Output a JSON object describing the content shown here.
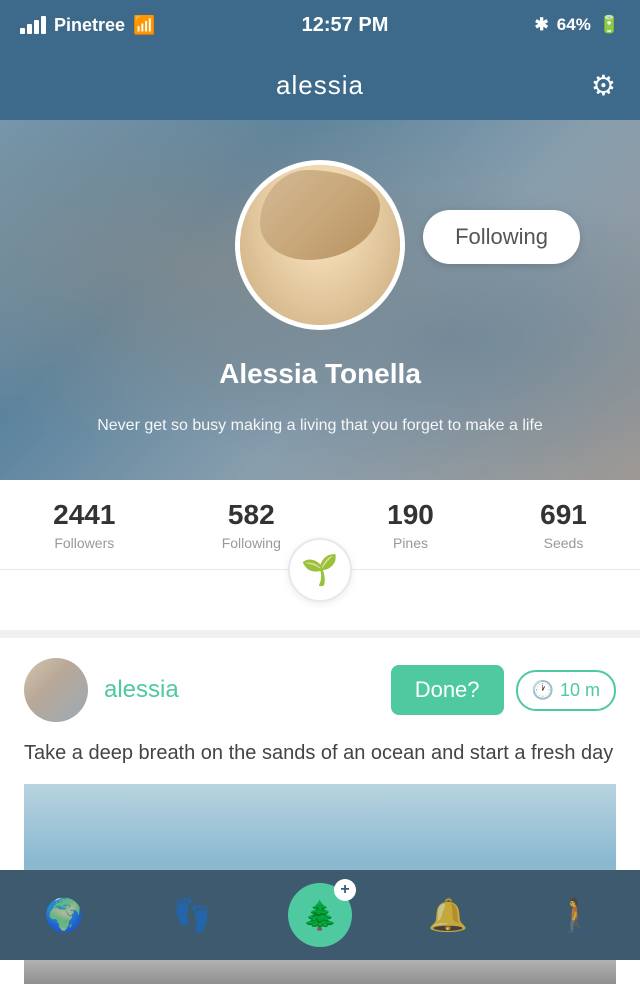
{
  "statusBar": {
    "carrier": "Pinetree",
    "time": "12:57 PM",
    "battery": "64%"
  },
  "header": {
    "title": "alessia",
    "gearLabel": "⚙"
  },
  "profile": {
    "name": "Alessia Tonella",
    "bio": "Never get so busy making a living that you forget to make a life",
    "followingBtn": "Following"
  },
  "stats": [
    {
      "number": "2441",
      "label": "Followers"
    },
    {
      "number": "582",
      "label": "Following"
    },
    {
      "number": "190",
      "label": "Pines"
    },
    {
      "number": "691",
      "label": "Seeds"
    }
  ],
  "post": {
    "username": "alessia",
    "doneBtn": "Done?",
    "timer": "10 m",
    "text": "Take a deep breath on the sands of an ocean and start a fresh day"
  },
  "nav": {
    "items": [
      {
        "icon": "🌍",
        "name": "explore"
      },
      {
        "icon": "👣",
        "name": "activity"
      },
      {
        "icon": "add",
        "name": "add"
      },
      {
        "icon": "🔔",
        "name": "notifications"
      },
      {
        "icon": "🚶",
        "name": "profile"
      }
    ]
  }
}
